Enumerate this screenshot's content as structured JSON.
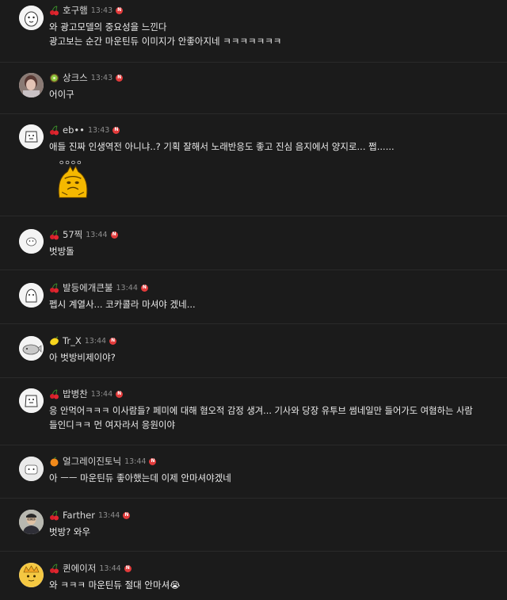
{
  "comments": [
    {
      "nick": "호구햄",
      "time": "13:43",
      "new": "N",
      "level_icon": "cherry-icon",
      "lines": [
        "와 광고모델의 중요성을 느낀다",
        "광고보는 순간 마운틴듀 이미지가 안좋아지네 ㅋㅋㅋㅋㅋㅋㅋ"
      ]
    },
    {
      "nick": "상크스",
      "time": "13:43",
      "new": "N",
      "level_icon": "kiwi-icon",
      "lines": [
        "어이구"
      ]
    },
    {
      "nick": "eb••",
      "time": "13:43",
      "new": "N",
      "level_icon": "cherry-icon",
      "lines": [
        "애들 진짜 인생역전 아니냐..? 기획 잘해서 노래반응도 좋고 진심 음지에서 양지로... 쩝......"
      ],
      "sticker": "ㅇㅇㅇㅇ"
    },
    {
      "nick": "57찍",
      "time": "13:44",
      "new": "N",
      "level_icon": "cherry-icon",
      "lines": [
        "벗방돌"
      ]
    },
    {
      "nick": "발등에개큰불",
      "time": "13:44",
      "new": "N",
      "level_icon": "cherry-icon",
      "lines": [
        "펩시 계열사... 코카콜라 마셔야 겠네..."
      ]
    },
    {
      "nick": "Tr_X",
      "time": "13:44",
      "new": "N",
      "level_icon": "lemon-icon",
      "lines": [
        "아 벗방비제이야?"
      ]
    },
    {
      "nick": "밥병찬",
      "time": "13:44",
      "new": "N",
      "level_icon": "cherry-icon",
      "lines": [
        "응 안먹어ㅋㅋㅋ 이사람들? 페미에 대해 혐오적 감정 생겨... 기사와 당장 유투브 썸네일만 들어가도 여혐하는 사람",
        "들인디ㅋㅋ 먼 여자라서 응원이야"
      ]
    },
    {
      "nick": "얼그레이진토닉",
      "time": "13:44",
      "new": "N",
      "level_icon": "orange-icon",
      "lines": [
        "아 ㅡㅡ 마운틴듀 좋아했는데 이제 안마셔야겠네"
      ]
    },
    {
      "nick": "Farther",
      "time": "13:44",
      "new": "N",
      "level_icon": "cherry-icon",
      "lines": [
        "벗방? 와우"
      ]
    },
    {
      "nick": "퀸에이저",
      "time": "13:44",
      "new": "N",
      "level_icon": "cherry-icon",
      "lines": [
        "와 ㅋㅋㅋ 마운틴듀 절대 안마셔"
      ],
      "emoji": "😭"
    }
  ],
  "colors": {
    "background": "#1b1b1b",
    "text": "#ececec",
    "time": "#8d8d8d",
    "new_badge": "#e23b3b"
  }
}
